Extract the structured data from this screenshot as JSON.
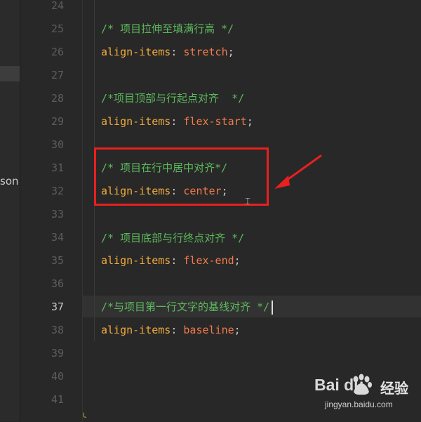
{
  "sidebar": {
    "partial_text": "son"
  },
  "editor": {
    "lines": [
      {
        "num": "24",
        "parts": []
      },
      {
        "num": "25",
        "parts": [
          {
            "t": "/* 项目拉伸至填满行高 */",
            "c": "comment"
          }
        ]
      },
      {
        "num": "26",
        "parts": [
          {
            "t": "align-items",
            "c": "prop"
          },
          {
            "t": ": ",
            "c": "punct"
          },
          {
            "t": "stretch",
            "c": "val"
          },
          {
            "t": ";",
            "c": "semi"
          }
        ]
      },
      {
        "num": "27",
        "parts": []
      },
      {
        "num": "28",
        "parts": [
          {
            "t": "/*项目顶部与行起点对齐  */",
            "c": "comment"
          }
        ]
      },
      {
        "num": "29",
        "parts": [
          {
            "t": "align-items",
            "c": "prop"
          },
          {
            "t": ": ",
            "c": "punct"
          },
          {
            "t": "flex-start",
            "c": "val"
          },
          {
            "t": ";",
            "c": "semi"
          }
        ]
      },
      {
        "num": "30",
        "parts": []
      },
      {
        "num": "31",
        "parts": [
          {
            "t": "/* 项目在行中居中对齐*/",
            "c": "comment"
          }
        ]
      },
      {
        "num": "32",
        "parts": [
          {
            "t": "align-items",
            "c": "prop"
          },
          {
            "t": ": ",
            "c": "punct"
          },
          {
            "t": "center",
            "c": "val"
          },
          {
            "t": ";",
            "c": "semi"
          }
        ]
      },
      {
        "num": "33",
        "parts": []
      },
      {
        "num": "34",
        "parts": [
          {
            "t": "/* 项目底部与行终点对齐 */",
            "c": "comment"
          }
        ]
      },
      {
        "num": "35",
        "parts": [
          {
            "t": "align-items",
            "c": "prop"
          },
          {
            "t": ": ",
            "c": "punct"
          },
          {
            "t": "flex-end",
            "c": "val"
          },
          {
            "t": ";",
            "c": "semi"
          }
        ]
      },
      {
        "num": "36",
        "parts": []
      },
      {
        "num": "37",
        "active": true,
        "caret": true,
        "parts": [
          {
            "t": "/*与项目第一行文字的基线对齐 */",
            "c": "comment"
          }
        ]
      },
      {
        "num": "38",
        "parts": [
          {
            "t": "align-items",
            "c": "prop"
          },
          {
            "t": ": ",
            "c": "punct"
          },
          {
            "t": "baseline",
            "c": "val"
          },
          {
            "t": ";",
            "c": "semi"
          }
        ]
      },
      {
        "num": "39",
        "parts": []
      },
      {
        "num": "40",
        "parts": []
      },
      {
        "num": "41",
        "parts": []
      }
    ]
  },
  "watermark": {
    "logo_text": "Bai   du",
    "suffix": "经验",
    "url": "jingyan.baidu.com"
  },
  "colors": {
    "background": "#282828",
    "comment": "#5cb85c",
    "property": "#f0a93b",
    "value": "#f27b4a",
    "highlight_box": "#e8201f",
    "arrow": "#e8201f"
  }
}
